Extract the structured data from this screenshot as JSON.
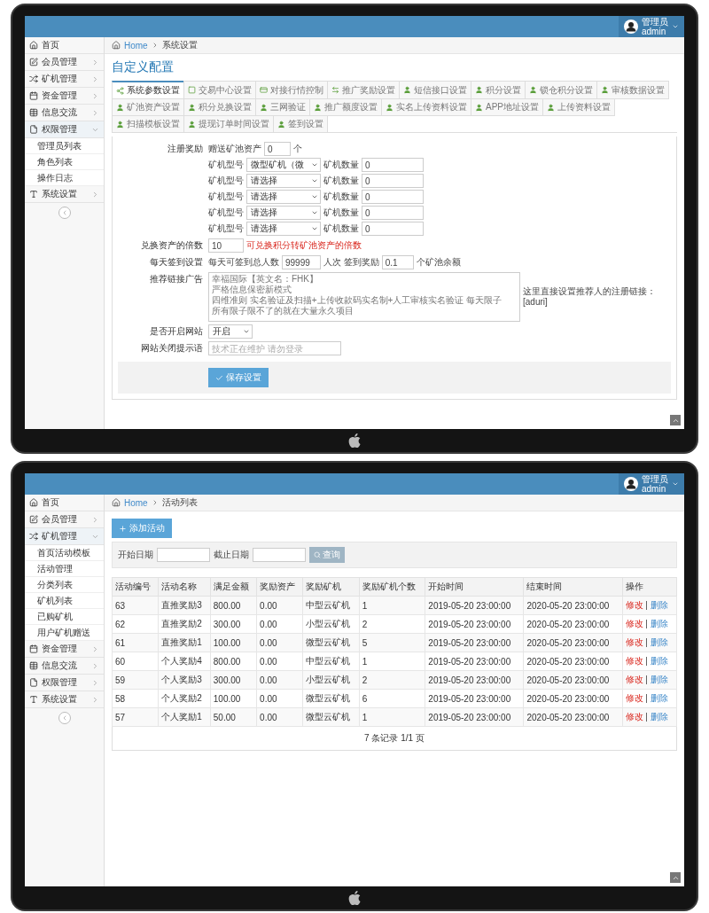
{
  "screens": [
    {
      "kind": "config",
      "header": {
        "role": "管理员",
        "user": "admin"
      },
      "sidebar": [
        {
          "label": "首页"
        },
        {
          "label": "会员管理",
          "expanded": false
        },
        {
          "label": "矿机管理",
          "expanded": false
        },
        {
          "label": "资金管理",
          "expanded": false
        },
        {
          "label": "信息交流",
          "expanded": false
        },
        {
          "label": "权限管理",
          "expanded": true,
          "children": [
            {
              "label": "管理员列表"
            },
            {
              "label": "角色列表"
            },
            {
              "label": "操作日志"
            }
          ]
        },
        {
          "label": "系统设置",
          "expanded": false
        }
      ],
      "breadcrumb": {
        "home": "Home",
        "current": "系统设置"
      },
      "title": "自定义配置",
      "tabs": [
        {
          "label": "系统参数设置",
          "selected": true
        },
        {
          "label": "交易中心设置",
          "selected": false
        },
        {
          "label": "对接行情控制",
          "selected": false
        },
        {
          "label": "推广奖励设置",
          "selected": false
        },
        {
          "label": "短信接口设置",
          "selected": false
        },
        {
          "label": "积分设置",
          "selected": false
        },
        {
          "label": "锁仓积分设置",
          "selected": false
        },
        {
          "label": "审核数据设置",
          "selected": false
        },
        {
          "label": "矿池资产设置",
          "selected": false
        },
        {
          "label": "积分兑换设置",
          "selected": false
        },
        {
          "label": "三网验证",
          "selected": false
        },
        {
          "label": "推广额度设置",
          "selected": false
        },
        {
          "label": "实名上传资料设置",
          "selected": false
        },
        {
          "label": "APP地址设置",
          "selected": false
        },
        {
          "label": "上传资料设置",
          "selected": false
        },
        {
          "label": "扫描模板设置",
          "selected": false
        },
        {
          "label": "提现订单时间设置",
          "selected": false
        },
        {
          "label": "签到设置",
          "selected": false
        }
      ],
      "form": {
        "register": {
          "label": "注册奖励",
          "prefix": "赠送矿池资产",
          "value": "0",
          "unit": "个",
          "machines": [
            {
              "type_label": "矿机型号",
              "type_value": "微型矿机（微",
              "count_label": "矿机数量",
              "count_value": "0"
            },
            {
              "type_label": "矿机型号",
              "type_value": "请选择",
              "count_label": "矿机数量",
              "count_value": "0"
            },
            {
              "type_label": "矿机型号",
              "type_value": "请选择",
              "count_label": "矿机数量",
              "count_value": "0"
            },
            {
              "type_label": "矿机型号",
              "type_value": "请选择",
              "count_label": "矿机数量",
              "count_value": "0"
            },
            {
              "type_label": "矿机型号",
              "type_value": "请选择",
              "count_label": "矿机数量",
              "count_value": "0"
            }
          ]
        },
        "exchange": {
          "label": "兑换资产的倍数",
          "value": "10",
          "hint": "可兑换积分转矿池资产的倍数"
        },
        "signin": {
          "label": "每天签到设置",
          "total_label": "每天可签到总人数",
          "total_value": "99999",
          "reward_label": "人次 签到奖励",
          "reward_value": "0.1",
          "reward_unit": "个矿池余额"
        },
        "ad": {
          "label": "推荐链接广告",
          "lines": [
            "幸福国际【英文名：FHK】",
            "严格信息保密新模式",
            "四维准则 实名验证及扫描+上传收款码实名制+人工审核实名验证 每天限子",
            "所有限子限不了的就在大量永久项目"
          ],
          "note": "这里直接设置推荐人的注册链接：[aduri]"
        },
        "site_open": {
          "label": "是否开启网站",
          "value": "开启"
        },
        "close_tip": {
          "label": "网站关闭提示语",
          "placeholder": "技术正在维护 请勿登录"
        }
      },
      "save_button": "保存设置"
    },
    {
      "kind": "list",
      "header": {
        "role": "管理员",
        "user": "admin"
      },
      "sidebar": [
        {
          "label": "首页"
        },
        {
          "label": "会员管理",
          "expanded": false
        },
        {
          "label": "矿机管理",
          "expanded": true,
          "children": [
            {
              "label": "首页活动模板"
            },
            {
              "label": "活动管理"
            },
            {
              "label": "分类列表"
            },
            {
              "label": "矿机列表"
            },
            {
              "label": "已购矿机"
            },
            {
              "label": "用户矿机赠送"
            }
          ]
        },
        {
          "label": "资金管理",
          "expanded": false
        },
        {
          "label": "信息交流",
          "expanded": false
        },
        {
          "label": "权限管理",
          "expanded": false
        },
        {
          "label": "系统设置",
          "expanded": false
        }
      ],
      "breadcrumb": {
        "home": "Home",
        "current": "活动列表"
      },
      "add_button": "添加活动",
      "filter": {
        "start_label": "开始日期",
        "end_label": "截止日期",
        "search_button": "查询"
      },
      "table": {
        "columns": [
          "活动编号",
          "活动名称",
          "满足金额",
          "奖励资产",
          "奖励矿机",
          "奖励矿机个数",
          "开始时间",
          "结束时间",
          "操作"
        ],
        "rows": [
          {
            "cells": [
              "63",
              "直推奖励3",
              "800.00",
              "0.00",
              "中型云矿机",
              "1",
              "2019-05-20 23:00:00",
              "2020-05-20 23:00:00"
            ],
            "edit": "修改",
            "separator": "|",
            "delete": "删除"
          },
          {
            "cells": [
              "62",
              "直推奖励2",
              "300.00",
              "0.00",
              "小型云矿机",
              "2",
              "2019-05-20 23:00:00",
              "2020-05-20 23:00:00"
            ],
            "edit": "修改",
            "separator": "|",
            "delete": "删除"
          },
          {
            "cells": [
              "61",
              "直推奖励1",
              "100.00",
              "0.00",
              "微型云矿机",
              "5",
              "2019-05-20 23:00:00",
              "2020-05-20 23:00:00"
            ],
            "edit": "修改",
            "separator": "|",
            "delete": "删除"
          },
          {
            "cells": [
              "60",
              "个人奖励4",
              "800.00",
              "0.00",
              "中型云矿机",
              "1",
              "2019-05-20 23:00:00",
              "2020-05-20 23:00:00"
            ],
            "edit": "修改",
            "separator": "|",
            "delete": "删除"
          },
          {
            "cells": [
              "59",
              "个人奖励3",
              "300.00",
              "0.00",
              "小型云矿机",
              "2",
              "2019-05-20 23:00:00",
              "2020-05-20 23:00:00"
            ],
            "edit": "修改",
            "separator": "|",
            "delete": "删除"
          },
          {
            "cells": [
              "58",
              "个人奖励2",
              "100.00",
              "0.00",
              "微型云矿机",
              "6",
              "2019-05-20 23:00:00",
              "2020-05-20 23:00:00"
            ],
            "edit": "修改",
            "separator": "|",
            "delete": "删除"
          },
          {
            "cells": [
              "57",
              "个人奖励1",
              "50.00",
              "0.00",
              "微型云矿机",
              "1",
              "2019-05-20 23:00:00",
              "2020-05-20 23:00:00"
            ],
            "edit": "修改",
            "separator": "|",
            "delete": "删除"
          }
        ]
      },
      "pagination": "7 条记录 1/1 页"
    }
  ]
}
